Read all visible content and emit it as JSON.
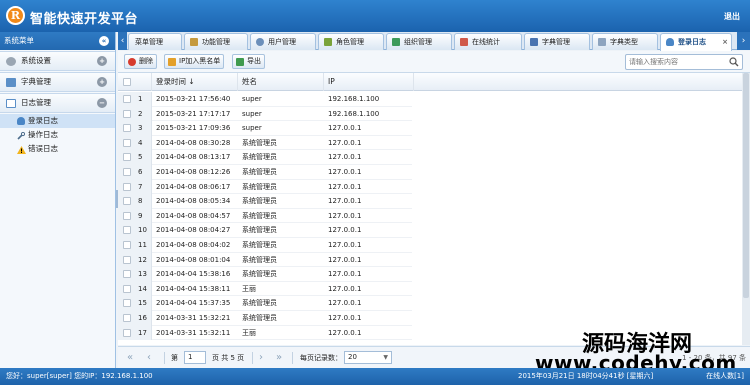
{
  "header": {
    "title": "智能快速开发平台",
    "logo_letter": "R",
    "logout": "退出"
  },
  "sidebar": {
    "title": "系统菜单",
    "groups": [
      {
        "label": "系统设置",
        "expanded": false
      },
      {
        "label": "字典管理",
        "expanded": false
      },
      {
        "label": "日志管理",
        "expanded": true
      }
    ],
    "log_items": [
      {
        "label": "登录日志",
        "active": true
      },
      {
        "label": "操作日志",
        "active": false
      },
      {
        "label": "错误日志",
        "active": false
      }
    ]
  },
  "tabs": [
    {
      "label": "菜单管理",
      "icon": "menu-icon"
    },
    {
      "label": "功能管理",
      "icon": "tag-icon"
    },
    {
      "label": "用户管理",
      "icon": "user-icon"
    },
    {
      "label": "角色管理",
      "icon": "puzzle-icon"
    },
    {
      "label": "组织管理",
      "icon": "org-icon"
    },
    {
      "label": "在线统计",
      "icon": "chart-icon"
    },
    {
      "label": "字典管理",
      "icon": "book-icon"
    },
    {
      "label": "字典类型",
      "icon": "doc-icon"
    },
    {
      "label": "登录日志",
      "icon": "login-icon",
      "active": true
    }
  ],
  "toolbar": {
    "delete_label": "删除",
    "blacklist_label": "IP加入黑名单",
    "export_label": "导出",
    "search_placeholder": "请输入搜索内容"
  },
  "grid": {
    "columns": [
      "登录时间 ↓",
      "姓名",
      "IP"
    ],
    "rows": [
      {
        "num": "1",
        "time": "2015-03-21 17:56:40",
        "name": "super",
        "ip": "192.168.1.100"
      },
      {
        "num": "2",
        "time": "2015-03-21 17:17:17",
        "name": "super",
        "ip": "192.168.1.100"
      },
      {
        "num": "3",
        "time": "2015-03-21 17:09:36",
        "name": "super",
        "ip": "127.0.0.1"
      },
      {
        "num": "4",
        "time": "2014-04-08 08:30:28",
        "name": "系统管理员",
        "ip": "127.0.0.1"
      },
      {
        "num": "5",
        "time": "2014-04-08 08:13:17",
        "name": "系统管理员",
        "ip": "127.0.0.1"
      },
      {
        "num": "6",
        "time": "2014-04-08 08:12:26",
        "name": "系统管理员",
        "ip": "127.0.0.1"
      },
      {
        "num": "7",
        "time": "2014-04-08 08:06:17",
        "name": "系统管理员",
        "ip": "127.0.0.1"
      },
      {
        "num": "8",
        "time": "2014-04-08 08:05:34",
        "name": "系统管理员",
        "ip": "127.0.0.1"
      },
      {
        "num": "9",
        "time": "2014-04-08 08:04:57",
        "name": "系统管理员",
        "ip": "127.0.0.1"
      },
      {
        "num": "10",
        "time": "2014-04-08 08:04:27",
        "name": "系统管理员",
        "ip": "127.0.0.1"
      },
      {
        "num": "11",
        "time": "2014-04-08 08:04:02",
        "name": "系统管理员",
        "ip": "127.0.0.1"
      },
      {
        "num": "12",
        "time": "2014-04-08 08:01:04",
        "name": "系统管理员",
        "ip": "127.0.0.1"
      },
      {
        "num": "13",
        "time": "2014-04-04 15:38:16",
        "name": "系统管理员",
        "ip": "127.0.0.1"
      },
      {
        "num": "14",
        "time": "2014-04-04 15:38:11",
        "name": "王丽",
        "ip": "127.0.0.1"
      },
      {
        "num": "15",
        "time": "2014-04-04 15:37:35",
        "name": "系统管理员",
        "ip": "127.0.0.1"
      },
      {
        "num": "16",
        "time": "2014-03-31 15:32:21",
        "name": "系统管理员",
        "ip": "127.0.0.1"
      },
      {
        "num": "17",
        "time": "2014-03-31 15:32:11",
        "name": "王丽",
        "ip": "127.0.0.1"
      }
    ]
  },
  "pager": {
    "first": "«",
    "prev": "‹",
    "next": "›",
    "last": "»",
    "page_prefix": "第",
    "page_value": "1",
    "page_suffix": "页 共 5 页",
    "size_label": "每页记录数：",
    "size_value": "20",
    "size_caret": "▼",
    "summary": "1 - 20 条，共 97 条"
  },
  "status": {
    "left": "您好：super[super] 您的IP：192.168.1.100",
    "mid": "2015年03月21日 18时04分41秒 [星期六]",
    "right": "在线人数[1]"
  },
  "watermark": {
    "line1": "源码海洋网",
    "line2": "www.codehy.com"
  },
  "colors": {
    "header_blue": "#1b63ae",
    "tab_active_text": "#1d4f86",
    "logo_orange": "#f18a1a"
  }
}
